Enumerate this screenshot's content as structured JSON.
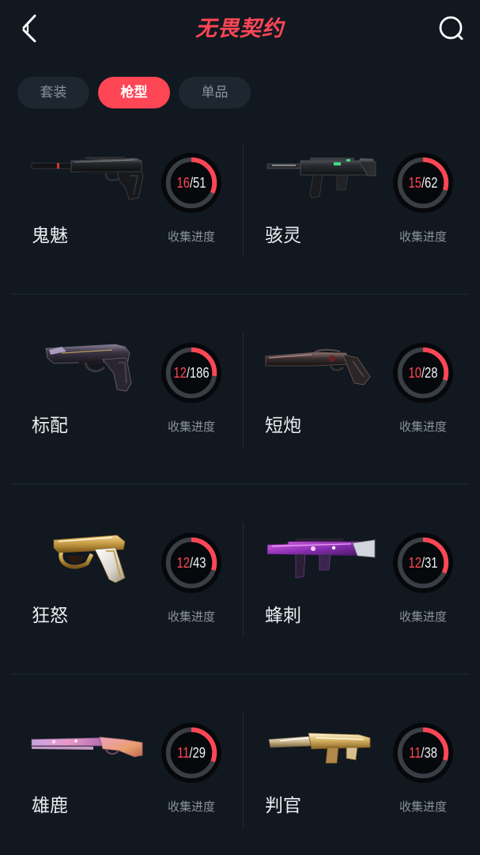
{
  "header": {
    "back_icon": "back-chevron-icon",
    "title": "无畏契约",
    "search_icon": "search-icon"
  },
  "tabs": [
    {
      "label": "套装",
      "active": false
    },
    {
      "label": "枪型",
      "active": true
    },
    {
      "label": "单品",
      "active": false
    }
  ],
  "colors": {
    "accent": "#ff4655",
    "background": "#111820",
    "tab_inactive": "#1e2630",
    "ring_track": "#3a3f46",
    "text_secondary": "#8a9199"
  },
  "weapons": [
    {
      "name": "鬼魅",
      "image": "ghost-pistol-image",
      "collected": "16",
      "total_text": "/51",
      "progress_label": "收集进度",
      "progress": 0.32
    },
    {
      "name": "骇灵",
      "image": "spectre-smg-image",
      "collected": "15",
      "total_text": "/62",
      "progress_label": "收集进度",
      "progress": 0.3
    },
    {
      "name": "标配",
      "image": "classic-pistol-image",
      "collected": "12",
      "total_text": "/186",
      "progress_label": "收集进度",
      "progress": 0.27
    },
    {
      "name": "短炮",
      "image": "shorty-shotgun-image",
      "collected": "10",
      "total_text": "/28",
      "progress_label": "收集进度",
      "progress": 0.3
    },
    {
      "name": "狂怒",
      "image": "frenzy-pistol-image",
      "collected": "12",
      "total_text": "/43",
      "progress_label": "收集进度",
      "progress": 0.3
    },
    {
      "name": "蜂刺",
      "image": "stinger-smg-image",
      "collected": "12",
      "total_text": "/31",
      "progress_label": "收集进度",
      "progress": 0.32
    },
    {
      "name": "雄鹿",
      "image": "bucky-shotgun-image",
      "collected": "11",
      "total_text": "/29",
      "progress_label": "收集进度",
      "progress": 0.31
    },
    {
      "name": "判官",
      "image": "judge-shotgun-image",
      "collected": "11",
      "total_text": "/38",
      "progress_label": "收集进度",
      "progress": 0.3
    }
  ]
}
